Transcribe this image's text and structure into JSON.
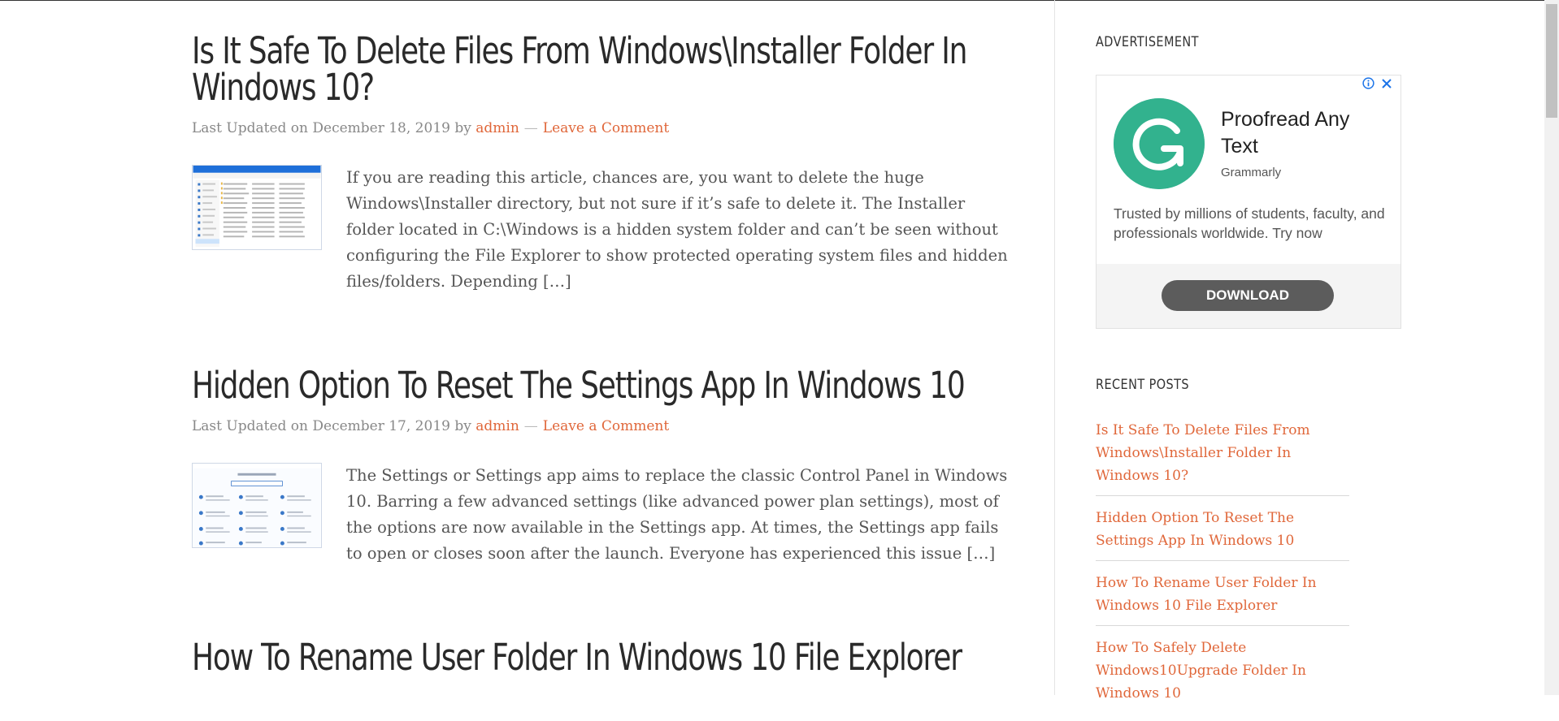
{
  "posts": [
    {
      "title_line1": "Is It Safe To Delete Files From Windows\\Installer Folder In",
      "title_line2": "Windows 10?",
      "meta_prefix": "Last Updated on December 18, 2019 by",
      "author": "admin",
      "separator": "—",
      "comment_link": "Leave a Comment",
      "excerpt": "If you are reading this article, chances are, you want to delete the huge Windows\\Installer directory, but not sure if it’s safe to delete it. The Installer folder located in C:\\Windows is a hidden system folder and can’t be seen without configuring the File Explorer to show protected operating system files and hidden files/folders. Depending […]"
    },
    {
      "title": "Hidden Option To Reset The Settings App In Windows 10",
      "meta_prefix": "Last Updated on December 17, 2019 by",
      "author": "admin",
      "separator": "—",
      "comment_link": "Leave a Comment",
      "excerpt": "The Settings or Settings app aims to replace the classic Control Panel in Windows 10. Barring a few advanced settings (like advanced power plan settings), most of the options are now available in the Settings app. At times, the Settings app fails to open or closes soon after the launch. Everyone has experienced this issue […]"
    },
    {
      "title": "How To Rename User Folder In Windows 10 File Explorer"
    }
  ],
  "sidebar": {
    "ad_title": "ADVERTISEMENT",
    "ad": {
      "headline": "Proofread Any Text",
      "brand": "Grammarly",
      "body": "Trusted by millions of students, faculty, and professionals worldwide. Try now",
      "button": "DOWNLOAD",
      "logo_color": "#32b28e"
    },
    "recent_title": "RECENT POSTS",
    "recent": [
      "Is It Safe To Delete Files From Windows\\Installer Folder In Windows 10?",
      "Hidden Option To Reset The Settings App In Windows 10",
      "How To Rename User Folder In Windows 10 File Explorer",
      "How To Safely Delete Windows10Upgrade Folder In Windows 10"
    ]
  },
  "colors": {
    "accent": "#e0673a",
    "title": "#2a2a2a",
    "text": "#555555"
  },
  "icons": [
    "adchoices-info-icon",
    "ad-close-icon",
    "grammarly-logo-icon"
  ]
}
